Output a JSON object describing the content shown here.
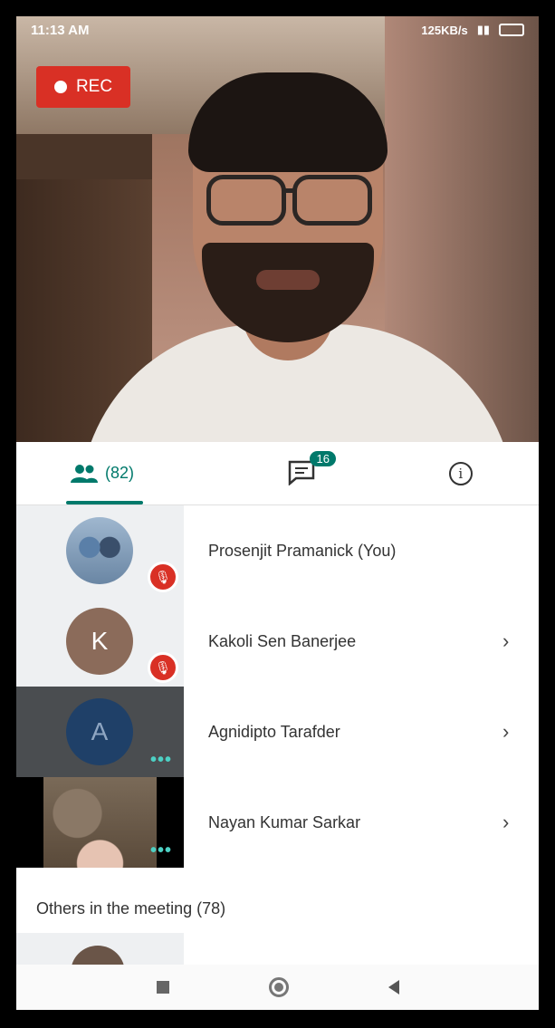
{
  "status_bar": {
    "time": "11:13 AM",
    "network_speed": "125KB/s",
    "battery_icon": "battery-icon"
  },
  "recording": {
    "label": "REC",
    "color": "#d93025"
  },
  "tabs": {
    "people_count": "(82)",
    "chat_badge": "16",
    "accent": "#00796b"
  },
  "participants": [
    {
      "name": "Prosenjit Pramanick (You)",
      "avatar_type": "photo",
      "muted": true
    },
    {
      "name": "Kakoli Sen Banerjee",
      "avatar_letter": "K",
      "muted": true
    },
    {
      "name": "Agnidipto Tarafder",
      "avatar_letter": "A",
      "speaking_dots": "•••"
    },
    {
      "name": "Nayan Kumar Sarkar",
      "avatar_type": "camera",
      "speaking_dots": "•••"
    }
  ],
  "chevron": "›",
  "others_section": "Others in the meeting (78)",
  "info_glyph": "i"
}
